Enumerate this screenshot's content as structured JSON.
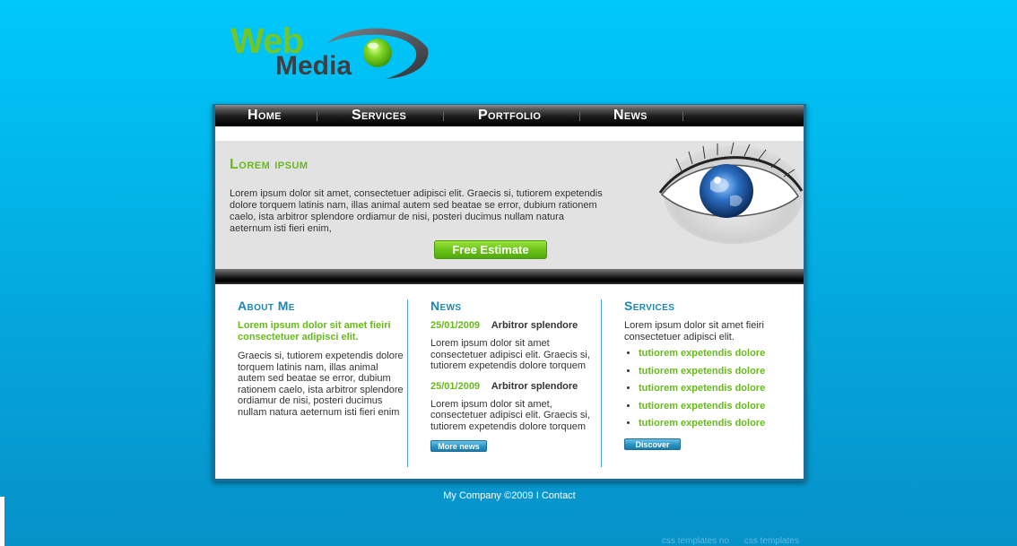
{
  "logo": {
    "word1": "Web",
    "word2": "Media"
  },
  "nav": {
    "items": [
      {
        "label": "Home"
      },
      {
        "label": "Services"
      },
      {
        "label": "Portfolio"
      },
      {
        "label": "News"
      }
    ]
  },
  "hero": {
    "title": "Lorem ipsum",
    "text": "Lorem ipsum dolor sit amet, consectetuer adipisci elit. Graecis si, tutiorem expetendis dolore torquem latinis nam, illas animal autem sed beatae se error, dubium rationem caelo, ista arbitror splendore ordiamur de nisi, posteri ducimus nullam natura aeternum isti fieri enim,",
    "cta": "Free Estimate"
  },
  "about": {
    "title": "About Me",
    "lead": "Lorem ipsum dolor sit amet fieiri consectetuer adipisci elit.",
    "text": "Graecis si, tutiorem expetendis dolore torquem latinis nam, illas animal autem sed beatae se error, dubium rationem caelo, ista arbitror splendore ordiamur de nisi, posteri ducimus nullam natura aeternum isti fieri enim"
  },
  "news": {
    "title": "News",
    "items": [
      {
        "date": "25/01/2009",
        "heading": "Arbitror splendore",
        "text": "Lorem ipsum dolor sit amet consectetuer adipisci elit. Graecis si, tutiorem expetendis dolore torquem"
      },
      {
        "date": "25/01/2009",
        "heading": "Arbitror splendore",
        "text": "Lorem ipsum dolor sit amet, consectetuer adipisci elit. Graecis si, tutiorem expetendis dolore torquem"
      }
    ],
    "button": "More news"
  },
  "services": {
    "title": "Services",
    "intro": "Lorem ipsum dolor sit amet fieiri consectetuer adipisci elit.",
    "items": [
      "tutiorem expetendis dolore",
      "tutiorem expetendis dolore",
      "tutiorem expetendis dolore",
      "tutiorem expetendis dolore",
      "tutiorem expetendis dolore"
    ],
    "button": "Discover"
  },
  "footer": {
    "text": "My Company ©2009 I Contact"
  },
  "credits": {
    "link1": "css templates no",
    "link2": "css templates"
  },
  "colors": {
    "accent_green": "#66bb19",
    "accent_blue": "#1a87b8",
    "background": "#04a8de"
  }
}
